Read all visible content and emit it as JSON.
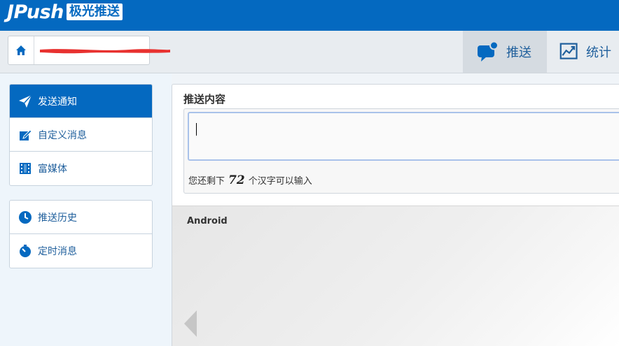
{
  "header": {
    "logo_text": "JPush",
    "logo_cn": "极光推送"
  },
  "subbar": {
    "nav": [
      {
        "label": "推送",
        "icon": "chat-bubble-icon",
        "active": true
      },
      {
        "label": "统计",
        "icon": "line-chart-icon",
        "active": false
      }
    ]
  },
  "sidebar": {
    "group1": [
      {
        "label": "发送通知",
        "icon": "send-icon",
        "active": true
      },
      {
        "label": "自定义消息",
        "icon": "edit-icon",
        "active": false
      },
      {
        "label": "富媒体",
        "icon": "film-icon",
        "active": false
      }
    ],
    "group2": [
      {
        "label": "推送历史",
        "icon": "clock-icon",
        "active": false
      },
      {
        "label": "定时消息",
        "icon": "timer-icon",
        "active": false
      }
    ]
  },
  "content": {
    "section_title": "推送内容",
    "textarea_value": "",
    "remain_prefix": "您还剩下",
    "remain_count": "72",
    "remain_suffix": "个汉字可以输入",
    "preview_platform": "Android"
  },
  "colors": {
    "brand_blue": "#0469c0",
    "link_blue": "#1f5f9c",
    "active_nav_bg": "#d5dbe1"
  }
}
